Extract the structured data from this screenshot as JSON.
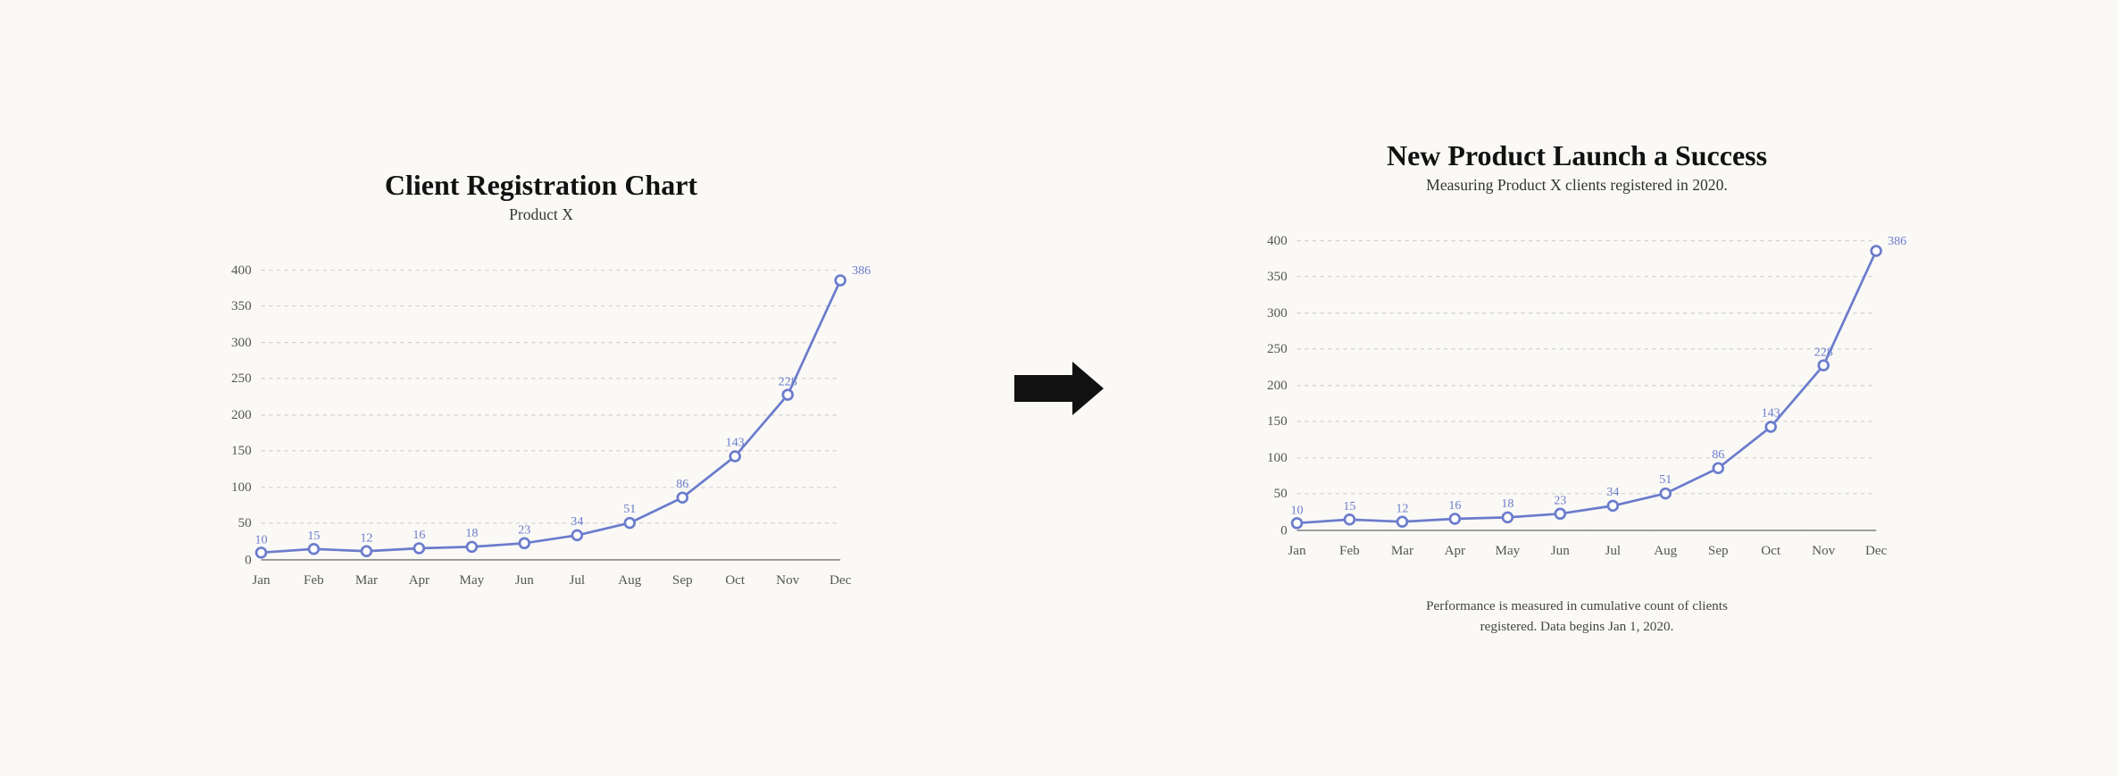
{
  "left_panel": {
    "title": "Client Registration Chart",
    "subtitle": "Product X"
  },
  "right_panel": {
    "title": "New Product Launch a Success",
    "subtitle": "Measuring Product X clients registered in 2020.",
    "footnote": "Performance is measured in cumulative count of clients\nregistered. Data begins Jan 1, 2020."
  },
  "chart": {
    "months": [
      "Jan",
      "Feb",
      "Mar",
      "Apr",
      "May",
      "Jun",
      "Jul",
      "Aug",
      "Sep",
      "Oct",
      "Nov",
      "Dec"
    ],
    "values": [
      10,
      15,
      12,
      16,
      18,
      23,
      34,
      51,
      86,
      143,
      228,
      386
    ],
    "y_labels": [
      0,
      50,
      100,
      150,
      200,
      250,
      300,
      350,
      400
    ],
    "line_color": "#6b7ccc",
    "dot_color": "#6b7ccc"
  },
  "arrow": {
    "label": "→"
  }
}
